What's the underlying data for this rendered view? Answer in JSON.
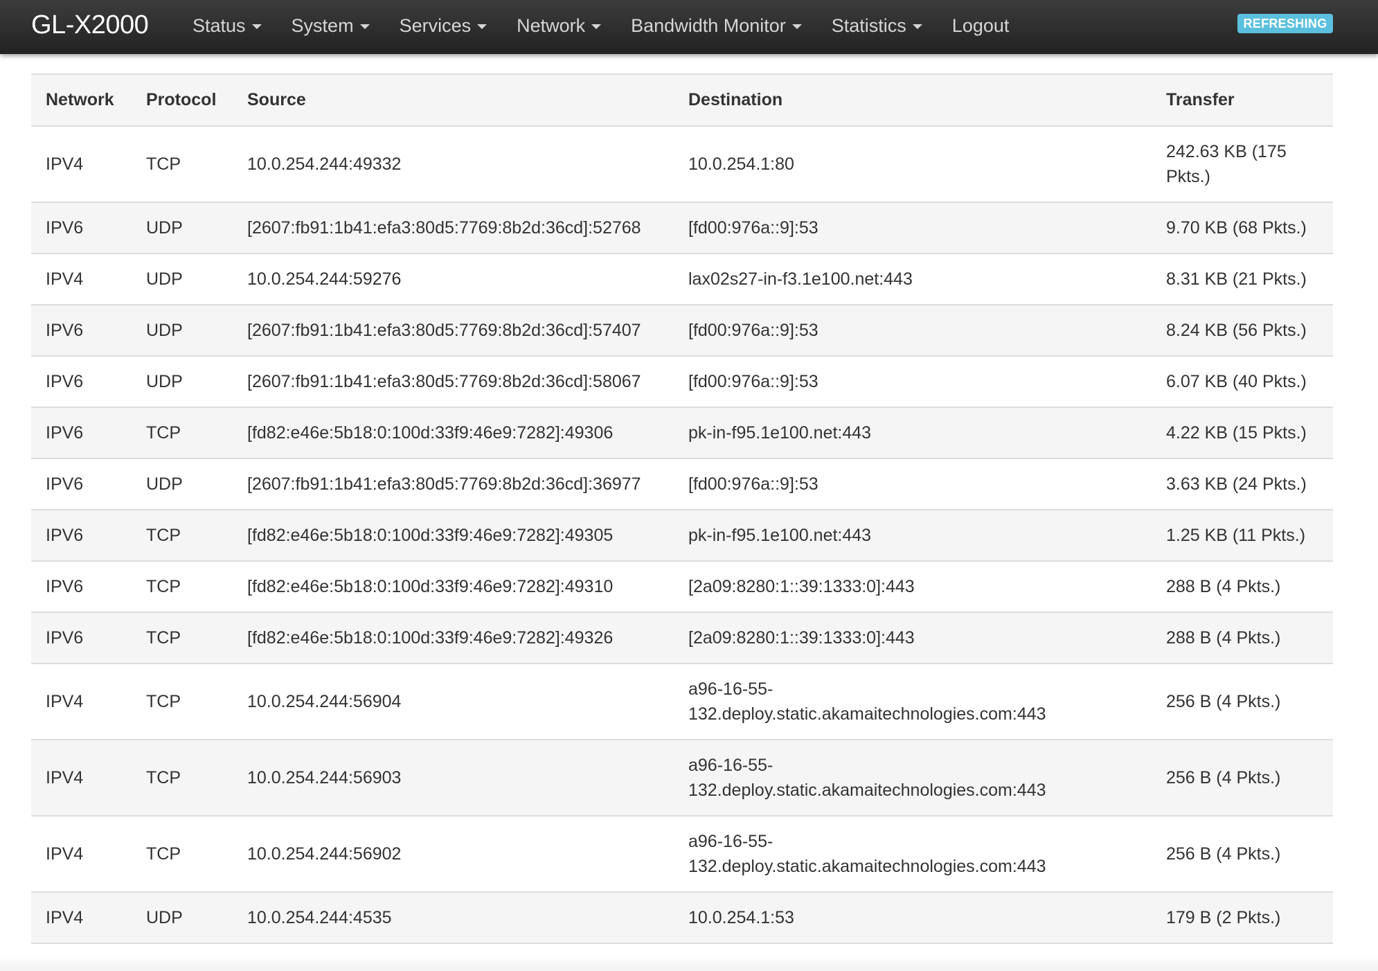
{
  "navbar": {
    "brand": "GL-X2000",
    "menu": [
      {
        "label": "Status",
        "dropdown": true
      },
      {
        "label": "System",
        "dropdown": true
      },
      {
        "label": "Services",
        "dropdown": true
      },
      {
        "label": "Network",
        "dropdown": true
      },
      {
        "label": "Bandwidth Monitor",
        "dropdown": true
      },
      {
        "label": "Statistics",
        "dropdown": true
      },
      {
        "label": "Logout",
        "dropdown": false
      }
    ],
    "status_badge": "REFRESHING",
    "status_badge_color": "#5bc0de"
  },
  "table": {
    "headers": {
      "network": "Network",
      "protocol": "Protocol",
      "source": "Source",
      "destination": "Destination",
      "transfer": "Transfer"
    },
    "rows": [
      {
        "network": "IPV4",
        "protocol": "TCP",
        "source": "10.0.254.244:49332",
        "destination": "10.0.254.1:80",
        "transfer": "242.63 KB (175 Pkts.)"
      },
      {
        "network": "IPV6",
        "protocol": "UDP",
        "source": "[2607:fb91:1b41:efa3:80d5:7769:8b2d:36cd]:52768",
        "destination": "[fd00:976a::9]:53",
        "transfer": "9.70 KB (68 Pkts.)"
      },
      {
        "network": "IPV4",
        "protocol": "UDP",
        "source": "10.0.254.244:59276",
        "destination": "lax02s27-in-f3.1e100.net:443",
        "transfer": "8.31 KB (21 Pkts.)"
      },
      {
        "network": "IPV6",
        "protocol": "UDP",
        "source": "[2607:fb91:1b41:efa3:80d5:7769:8b2d:36cd]:57407",
        "destination": "[fd00:976a::9]:53",
        "transfer": "8.24 KB (56 Pkts.)"
      },
      {
        "network": "IPV6",
        "protocol": "UDP",
        "source": "[2607:fb91:1b41:efa3:80d5:7769:8b2d:36cd]:58067",
        "destination": "[fd00:976a::9]:53",
        "transfer": "6.07 KB (40 Pkts.)"
      },
      {
        "network": "IPV6",
        "protocol": "TCP",
        "source": "[fd82:e46e:5b18:0:100d:33f9:46e9:7282]:49306",
        "destination": "pk-in-f95.1e100.net:443",
        "transfer": "4.22 KB (15 Pkts.)"
      },
      {
        "network": "IPV6",
        "protocol": "UDP",
        "source": "[2607:fb91:1b41:efa3:80d5:7769:8b2d:36cd]:36977",
        "destination": "[fd00:976a::9]:53",
        "transfer": "3.63 KB (24 Pkts.)"
      },
      {
        "network": "IPV6",
        "protocol": "TCP",
        "source": "[fd82:e46e:5b18:0:100d:33f9:46e9:7282]:49305",
        "destination": "pk-in-f95.1e100.net:443",
        "transfer": "1.25 KB (11 Pkts.)"
      },
      {
        "network": "IPV6",
        "protocol": "TCP",
        "source": "[fd82:e46e:5b18:0:100d:33f9:46e9:7282]:49310",
        "destination": "[2a09:8280:1::39:1333:0]:443",
        "transfer": "288 B (4 Pkts.)"
      },
      {
        "network": "IPV6",
        "protocol": "TCP",
        "source": "[fd82:e46e:5b18:0:100d:33f9:46e9:7282]:49326",
        "destination": "[2a09:8280:1::39:1333:0]:443",
        "transfer": "288 B (4 Pkts.)"
      },
      {
        "network": "IPV4",
        "protocol": "TCP",
        "source": "10.0.254.244:56904",
        "destination": "a96-16-55-132.deploy.static.akamaitechnologies.com:443",
        "transfer": "256 B (4 Pkts.)"
      },
      {
        "network": "IPV4",
        "protocol": "TCP",
        "source": "10.0.254.244:56903",
        "destination": "a96-16-55-132.deploy.static.akamaitechnologies.com:443",
        "transfer": "256 B (4 Pkts.)"
      },
      {
        "network": "IPV4",
        "protocol": "TCP",
        "source": "10.0.254.244:56902",
        "destination": "a96-16-55-132.deploy.static.akamaitechnologies.com:443",
        "transfer": "256 B (4 Pkts.)"
      },
      {
        "network": "IPV4",
        "protocol": "UDP",
        "source": "10.0.254.244:4535",
        "destination": "10.0.254.1:53",
        "transfer": "179 B (2 Pkts.)"
      }
    ]
  }
}
